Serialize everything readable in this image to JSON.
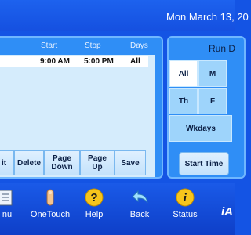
{
  "header": {
    "datetime": "Mon March 13, 20"
  },
  "schedule": {
    "columns": {
      "start": "Start",
      "stop": "Stop",
      "days": "Days"
    },
    "rows": [
      {
        "start": "9:00 AM",
        "stop": "5:00 PM",
        "days": "All"
      }
    ],
    "buttons": {
      "edit": "it",
      "delete": "Delete",
      "page_down_line1": "Page",
      "page_down_line2": "Down",
      "page_up_line1": "Page",
      "page_up_line2": "Up",
      "save": "Save"
    }
  },
  "run_days": {
    "title": "Run D",
    "days": {
      "all": "All",
      "mon": "M",
      "thu": "Th",
      "fri": "F",
      "weekdays": "Wkdays"
    },
    "selected": "All",
    "start_time_label": "Start Time"
  },
  "nav": {
    "menu": "nu",
    "onetouch": "OneTouch",
    "help": "Help",
    "back": "Back",
    "status": "Status"
  },
  "logo_text": "iA",
  "colors": {
    "background": "#1454e4",
    "panel": "#2f8ef6",
    "selected_day": "#ffffff",
    "day_button": "#9ed4fb",
    "help_icon": "#f7c51c",
    "status_icon": "#f7c51c"
  }
}
